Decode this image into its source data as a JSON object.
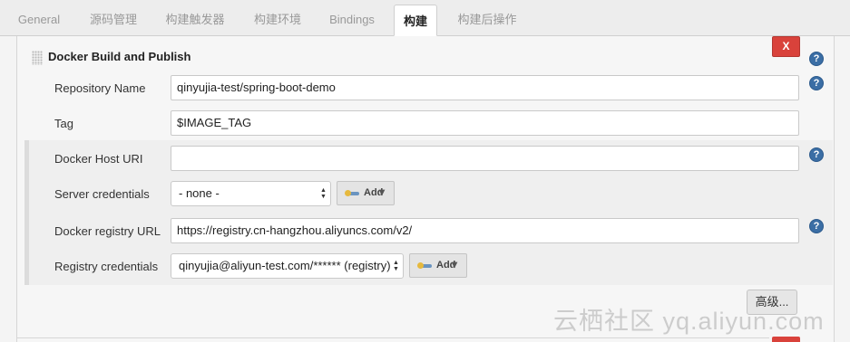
{
  "tabs": [
    {
      "label": "General"
    },
    {
      "label": "源码管理"
    },
    {
      "label": "构建触发器"
    },
    {
      "label": "构建环境"
    },
    {
      "label": "Bindings"
    },
    {
      "label": "构建"
    },
    {
      "label": "构建后操作"
    }
  ],
  "active_tab": "构建",
  "section": {
    "title": "Docker Build and Publish",
    "delete_label": "X"
  },
  "fields": {
    "repository_name": {
      "label": "Repository Name",
      "value": "qinyujia-test/spring-boot-demo"
    },
    "tag": {
      "label": "Tag",
      "value": "$IMAGE_TAG"
    },
    "docker_host_uri": {
      "label": "Docker Host URI",
      "value": ""
    },
    "server_credentials": {
      "label": "Server credentials",
      "selected": "- none -"
    },
    "docker_registry_url": {
      "label": "Docker registry URL",
      "value": "https://registry.cn-hangzhou.aliyuncs.com/v2/"
    },
    "registry_credentials": {
      "label": "Registry credentials",
      "selected": "qinyujia@aliyun-test.com/****** (registry)"
    }
  },
  "add_button_label": "Add",
  "help_glyph": "?",
  "advanced_label": "高级...",
  "watermark": "云栖社区 yq.aliyun.com",
  "colors": {
    "delete": "#d9423b",
    "help": "#3b6ea5"
  }
}
